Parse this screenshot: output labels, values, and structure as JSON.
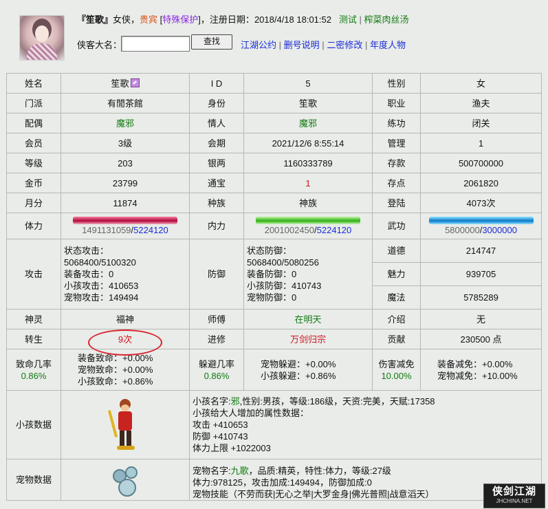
{
  "header": {
    "name": "『笙歌』",
    "gender": "女侠，",
    "rank": "贵宾",
    "bracket_open": " [",
    "protect": "特殊保护",
    "bracket_close": "]，",
    "reg_label": "注册日期：",
    "reg_date": "2018/4/18 18:01:52",
    "test_link": "测试",
    "sep": "|",
    "fan_link": "榨菜肉丝汤",
    "search_label": "侠客大名：",
    "search_value": "",
    "search_button": "查找",
    "links": [
      "江湖公约",
      "删号说明",
      "二密修改",
      "年度人物"
    ]
  },
  "profile": {
    "rows1": [
      [
        [
          "姓名",
          "笙歌"
        ],
        [
          "I D",
          "5"
        ],
        [
          "性别",
          "女"
        ]
      ],
      [
        [
          "门派",
          "有閒茶館"
        ],
        [
          "身份",
          "笙歌"
        ],
        [
          "职业",
          "渔夫"
        ]
      ],
      [
        [
          "配偶",
          "魔邪"
        ],
        [
          "情人",
          "魔邪"
        ],
        [
          "练功",
          "闭关"
        ]
      ],
      [
        [
          "会员",
          "3级"
        ],
        [
          "会期",
          "2021/12/6 8:55:14"
        ],
        [
          "管理",
          "1"
        ]
      ],
      [
        [
          "等级",
          "203"
        ],
        [
          "银两",
          "1160333789"
        ],
        [
          "存款",
          "500700000"
        ]
      ],
      [
        [
          "金币",
          "23799"
        ],
        [
          "通宝",
          "1"
        ],
        [
          "存点",
          "2061820"
        ]
      ],
      [
        [
          "月分",
          "11874"
        ],
        [
          "种族",
          "神族"
        ],
        [
          "登陆",
          "4073次"
        ]
      ]
    ],
    "hp": {
      "label": "体力",
      "cur": "1491131059",
      "max": "5224120",
      "fill": 1.0
    },
    "mp": {
      "label": "内力",
      "cur": "2001002450",
      "max": "5224120",
      "fill": 1.0
    },
    "wg": {
      "label": "武功",
      "cur": "5800000",
      "max": "3000000",
      "fill": 1.0
    },
    "attack": {
      "label": "攻击",
      "lines": [
        "状态攻击：",
        "5068400/5100320",
        "装备攻击：0",
        "小孩攻击：410653",
        "宠物攻击：149494"
      ]
    },
    "defense": {
      "label": "防御",
      "lines": [
        "状态防御：",
        "5068400/5080256",
        "装备防御：0",
        "小孩防御：410743",
        "宠物防御：0"
      ]
    },
    "side": [
      [
        "道德",
        "214747"
      ],
      [
        "魅力",
        "939705"
      ],
      [
        "魔法",
        "5785289"
      ]
    ],
    "spirit": [
      [
        "神灵",
        "福神"
      ],
      [
        "师傅",
        "在明天"
      ],
      [
        "介绍",
        "无"
      ]
    ],
    "rebirth": [
      [
        "转生",
        "9次"
      ],
      [
        "进修",
        "万剑归宗"
      ],
      [
        "贡献",
        "230500 点"
      ]
    ],
    "crit": {
      "label": "致命几率",
      "value": "0.86%",
      "lines": [
        "装备致命：+0.00%",
        "宠物致命：+0.00%",
        "小孩致命：+0.86%"
      ]
    },
    "dodge": {
      "label": "躲避几率",
      "value": "0.86%",
      "lines": [
        "宠物躲避：+0.00%",
        "小孩躲避：+0.86%"
      ]
    },
    "reduce": {
      "label": "伤害减免",
      "value": "10.00%",
      "lines": [
        "装备减免：+0.00%",
        "宠物减免：+10.00%"
      ]
    },
    "child": {
      "label": "小孩数据",
      "name_pre": "小孩名字:",
      "name": "邪",
      "info": ",性别:男孩，等级:186级，天资:完美，天赋:17358",
      "lines": [
        "小孩给大人增加的属性数据：",
        "攻击 +410653",
        "防御 +410743",
        "体力上限 +1022003"
      ]
    },
    "pet": {
      "label": "宠物数据",
      "name_pre": "宠物名字:",
      "name": "九歌",
      "info": "，品质:精英，特性:体力，等级:27级",
      "lines": [
        "体力:978125，攻击加成:149494，防御加成:0",
        "宠物技能（不劳而获|无心之举|大罗金身|佛光普照|战意滔天）"
      ]
    }
  },
  "watermark": {
    "title": "侠剑江湖",
    "url": "JHCHINA.NET"
  },
  "colors": {
    "green": "#117a11",
    "link": "#1a2bd8",
    "red": "#d0111b",
    "orange": "#d8541c",
    "purple": "#8a2be2"
  }
}
